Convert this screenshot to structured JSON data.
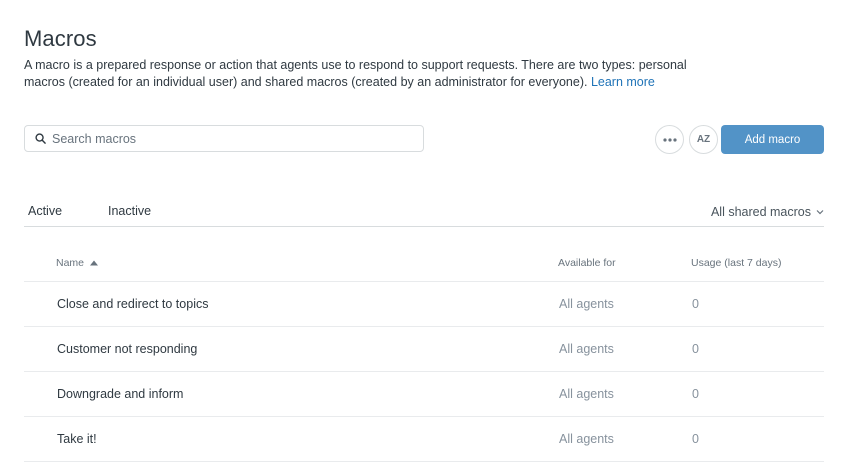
{
  "header": {
    "title": "Macros",
    "description": "A macro is a prepared response or action that agents use to respond to support requests. There are two types: personal macros (created for an individual user) and shared macros (created by an administrator for everyone).",
    "learn_more": "Learn more"
  },
  "search": {
    "placeholder": "Search macros",
    "value": ""
  },
  "toolbar": {
    "more_icon": "ellipsis-icon",
    "sort_icon": "sort-az-icon",
    "sort_label": "AZ",
    "add_label": "Add macro"
  },
  "tabs": [
    {
      "label": "Active",
      "selected": true
    },
    {
      "label": "Inactive",
      "selected": false
    }
  ],
  "filter": {
    "label": "All shared macros"
  },
  "table": {
    "columns": [
      "Name",
      "Available for",
      "Usage (last 7 days)"
    ],
    "rows": [
      {
        "name": "Close and redirect to topics",
        "available": "All agents",
        "usage": "0"
      },
      {
        "name": "Customer not responding",
        "available": "All agents",
        "usage": "0"
      },
      {
        "name": "Downgrade and inform",
        "available": "All agents",
        "usage": "0"
      },
      {
        "name": "Take it!",
        "available": "All agents",
        "usage": "0"
      }
    ]
  },
  "colors": {
    "primary_button": "#5293c7",
    "link": "#1f73b7",
    "border": "#d8dcde",
    "muted_text": "#87929d"
  }
}
